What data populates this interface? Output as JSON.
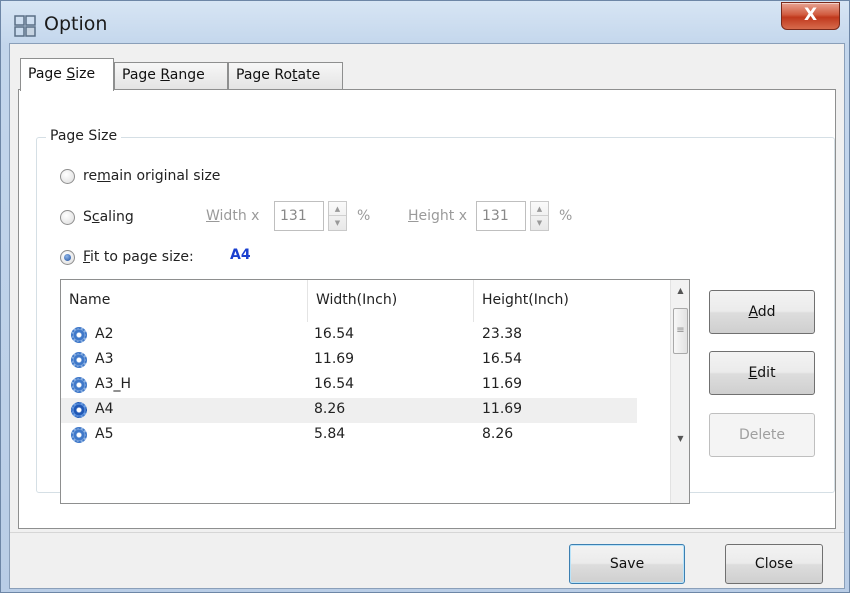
{
  "window": {
    "title": "Option",
    "close_label": "X"
  },
  "tabs": [
    {
      "pre": "Page ",
      "accel": "S",
      "post": "ize"
    },
    {
      "pre": "Page ",
      "accel": "R",
      "post": "ange"
    },
    {
      "pre": "Page Ro",
      "accel": "t",
      "post": "ate"
    }
  ],
  "group": {
    "title": "Page Size",
    "remain": {
      "pre": "re",
      "accel": "m",
      "post": "ain original size"
    },
    "scaling": {
      "pre": "S",
      "accel": "c",
      "post": "aling",
      "width_pre": "",
      "width_accel": "W",
      "width_post": "idth x",
      "width_value": "131",
      "pct1": "%",
      "height_pre": "",
      "height_accel": "H",
      "height_post": "eight x",
      "height_value": "131",
      "pct2": "%"
    },
    "fit": {
      "pre": "",
      "accel": "F",
      "post": "it to page size:",
      "value": "A4"
    }
  },
  "table": {
    "columns": [
      "Name",
      "Width(Inch)",
      "Height(Inch)"
    ],
    "rows": [
      {
        "name": "A2",
        "width": "16.54",
        "height": "23.38"
      },
      {
        "name": "A3",
        "width": "11.69",
        "height": "16.54"
      },
      {
        "name": "A3_H",
        "width": "16.54",
        "height": "11.69"
      },
      {
        "name": "A4",
        "width": "8.26",
        "height": "11.69"
      },
      {
        "name": "A5",
        "width": "5.84",
        "height": "8.26"
      }
    ],
    "selected_row": "A4"
  },
  "side_buttons": {
    "add": {
      "accel": "A",
      "post": "dd"
    },
    "edit": {
      "accel": "E",
      "post": "dit"
    },
    "delete": "Delete"
  },
  "footer": {
    "save": "Save",
    "close": "Close"
  },
  "colors": {
    "selected_value": "#1a3fcf",
    "close_button": "#c0391d"
  },
  "icons": {
    "app": "app-grid-icon",
    "row": "gear-icon"
  }
}
